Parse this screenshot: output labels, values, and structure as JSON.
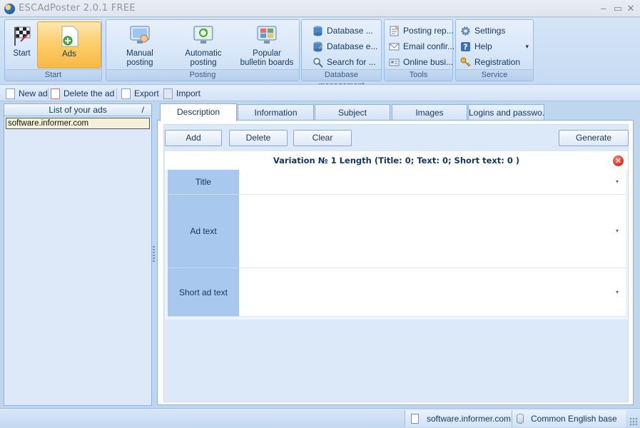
{
  "window": {
    "title": "ESCAdPoster 2.0.1 FREE",
    "controls": [
      "–",
      "▭",
      "✕"
    ]
  },
  "ribbon": {
    "groups": [
      {
        "label": "Start",
        "buttons": [
          "Start",
          "Ads"
        ]
      },
      {
        "label": "Posting",
        "buttons": [
          "Manual posting",
          "Automatic posting",
          "Popular bulletin boards"
        ]
      },
      {
        "label": "Database management",
        "buttons": [
          "Database ...",
          "Database e...",
          "Search for ..."
        ]
      },
      {
        "label": "Tools",
        "buttons": [
          "Posting rep...",
          "Email confir...",
          "Online busi..."
        ]
      },
      {
        "label": "Service",
        "buttons": [
          "Settings",
          "Help",
          "Registration"
        ]
      }
    ],
    "start": {
      "start": "Start",
      "ads": "Ads"
    },
    "posting": {
      "manual_1": "Manual",
      "manual_2": "posting",
      "auto_1": "Automatic",
      "auto_2": "posting",
      "popular_1": "Popular",
      "popular_2": "bulletin boards"
    },
    "help_arrow": "▾"
  },
  "toolbar": {
    "new_ad": "New ad",
    "delete_ad": "Delete the ad",
    "export": "Export",
    "import": "Import"
  },
  "ads_list": {
    "header": "List of your ads",
    "sort_glyph": "/",
    "items": [
      "software.informer.com"
    ]
  },
  "tabs": [
    "Description",
    "Information",
    "Subject",
    "Images",
    "Logins and passwo..."
  ],
  "description": {
    "buttons": {
      "add": "Add",
      "delete": "Delete",
      "clear": "Clear",
      "generate": "Generate"
    },
    "variation_header": "Variation № 1 Length (Title: 0;  Text: 0;  Short text: 0 )",
    "close_glyph": "✕",
    "fields": [
      {
        "label": "Title",
        "value": ""
      },
      {
        "label": "Ad text",
        "value": ""
      },
      {
        "label": "Short ad text",
        "value": ""
      }
    ],
    "dropdown_glyph": "▾"
  },
  "statusbar": {
    "current_ad": "software.informer.com",
    "database": "Common English base"
  },
  "colors": {
    "accent": "#fccf6d",
    "ribbon": "#d6e6f8",
    "field_label": "#a9c8ee"
  }
}
